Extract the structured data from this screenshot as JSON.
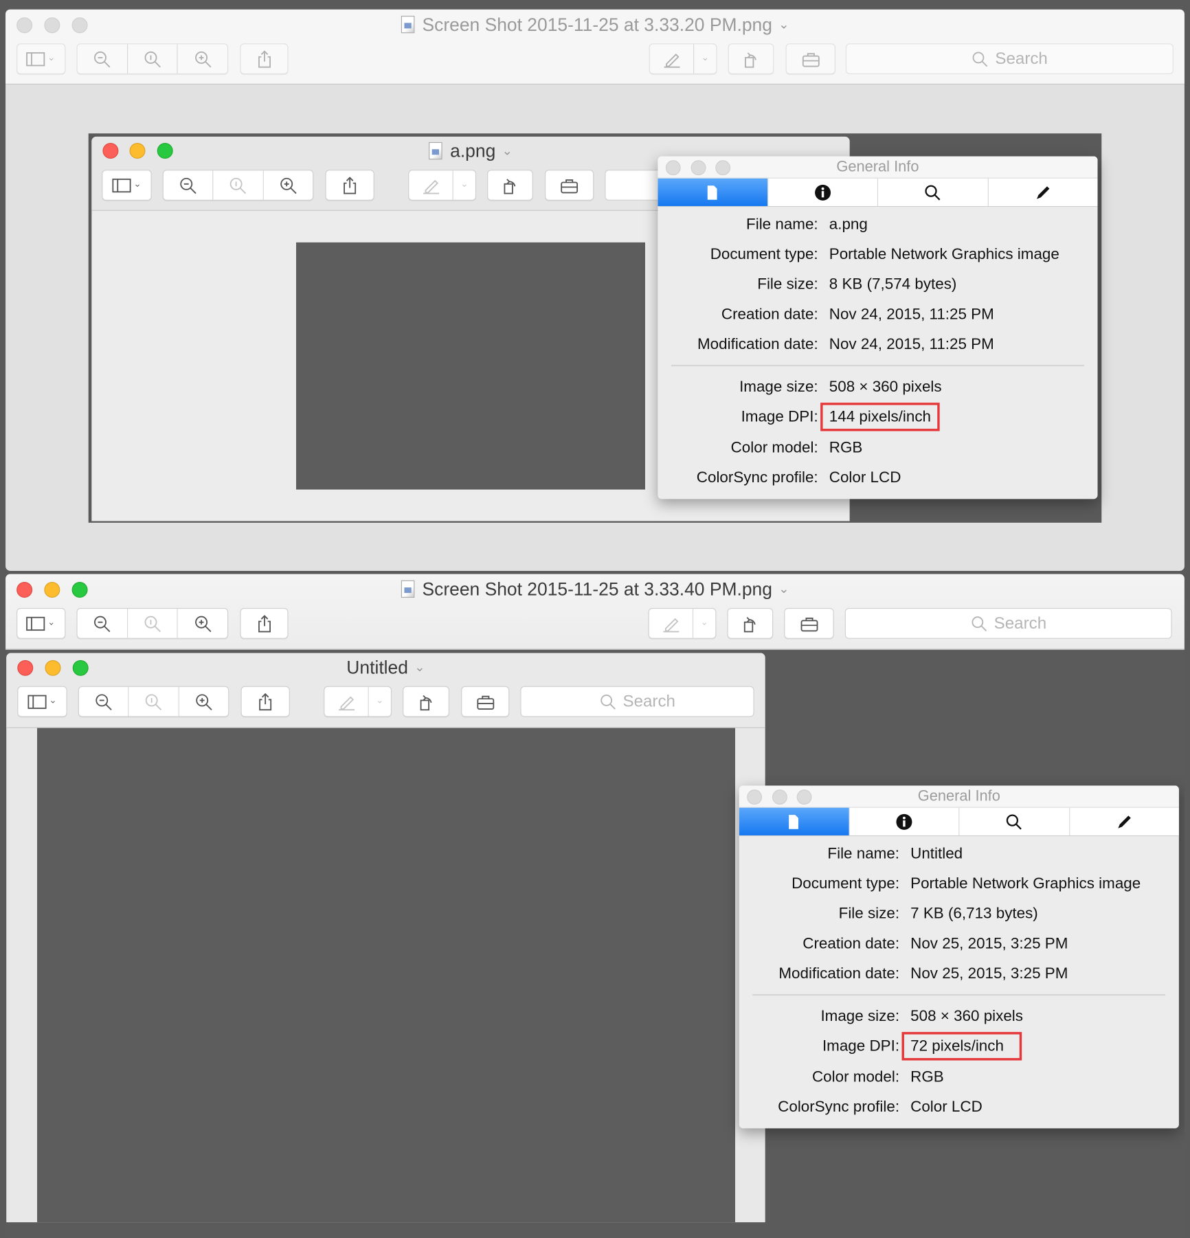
{
  "colors": {
    "accent_tab": "#1678f0",
    "highlight": "#e5383b",
    "image_fill": "#5d5d5d"
  },
  "windows": [
    {
      "title": "Screen Shot 2015-11-25 at 3.33.20 PM.png",
      "search_placeholder": "Search",
      "state": "inactive",
      "inner": {
        "title": "a.png"
      },
      "info": {
        "title": "General Info",
        "tabs": [
          "file-icon",
          "info-icon",
          "search-icon",
          "pencil-icon"
        ],
        "rows": [
          {
            "label": "File name:",
            "value": "a.png"
          },
          {
            "label": "Document type:",
            "value": "Portable Network Graphics image"
          },
          {
            "label": "File size:",
            "value": "8 KB (7,574 bytes)"
          },
          {
            "label": "Creation date:",
            "value": "Nov 24, 2015, 11:25 PM"
          },
          {
            "label": "Modification date:",
            "value": "Nov 24, 2015, 11:25 PM"
          },
          {
            "label": "Image size:",
            "value": "508 × 360 pixels"
          },
          {
            "label": "Image DPI:",
            "value": "144 pixels/inch",
            "highlighted": true
          },
          {
            "label": "Color model:",
            "value": "RGB"
          },
          {
            "label": "ColorSync profile:",
            "value": "Color LCD"
          }
        ]
      }
    },
    {
      "title": "Screen Shot 2015-11-25 at 3.33.40 PM.png",
      "search_placeholder": "Search",
      "state": "active",
      "inner": {
        "title": "Untitled",
        "search_placeholder": "Search"
      },
      "info": {
        "title": "General Info",
        "tabs": [
          "file-icon",
          "info-icon",
          "search-icon",
          "pencil-icon"
        ],
        "rows": [
          {
            "label": "File name:",
            "value": "Untitled"
          },
          {
            "label": "Document type:",
            "value": "Portable Network Graphics image"
          },
          {
            "label": "File size:",
            "value": "7 KB (6,713 bytes)"
          },
          {
            "label": "Creation date:",
            "value": "Nov 25, 2015, 3:25 PM"
          },
          {
            "label": "Modification date:",
            "value": "Nov 25, 2015, 3:25 PM"
          },
          {
            "label": "Image size:",
            "value": "508 × 360 pixels"
          },
          {
            "label": "Image DPI:",
            "value": "72 pixels/inch",
            "highlighted": true
          },
          {
            "label": "Color model:",
            "value": "RGB"
          },
          {
            "label": "ColorSync profile:",
            "value": "Color LCD"
          }
        ]
      }
    }
  ]
}
